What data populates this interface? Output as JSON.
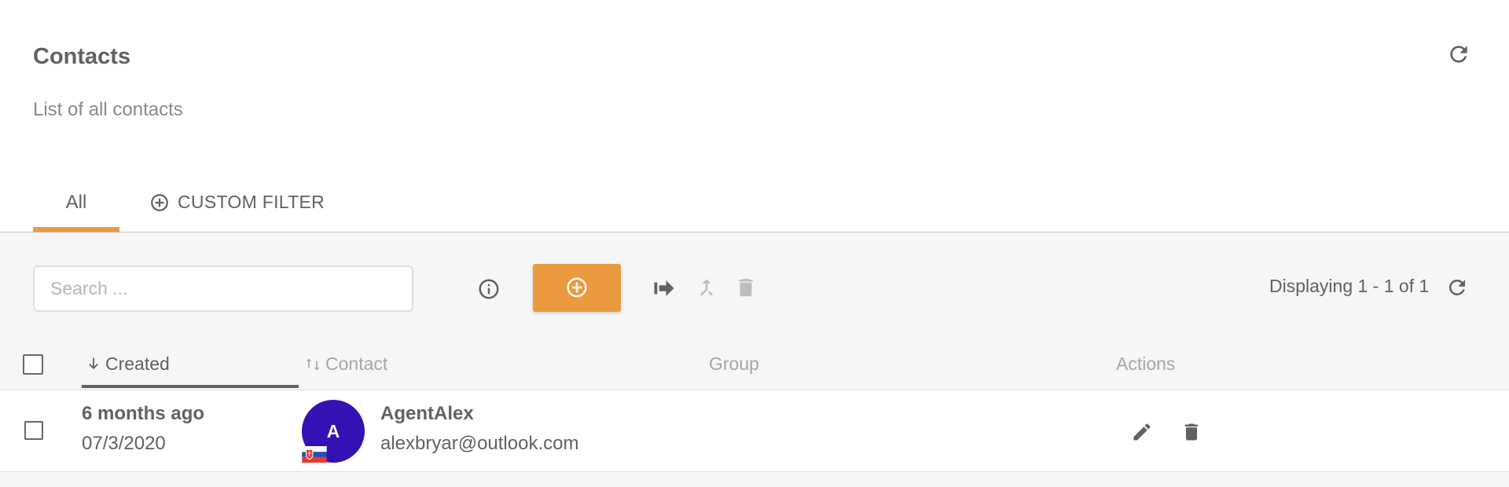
{
  "header": {
    "title": "Contacts",
    "subtitle": "List of all contacts",
    "refresh_icon": "refresh-icon"
  },
  "tabs": [
    {
      "label": "All",
      "active": true
    },
    {
      "label": "CUSTOM FILTER",
      "icon": "add-circle-outline-icon",
      "active": false
    }
  ],
  "toolbar": {
    "search_placeholder": "Search ...",
    "search_value": "",
    "info_icon": "info-icon",
    "add_icon": "add-circle-icon",
    "export_icon": "export-icon",
    "merge_icon": "merge-icon",
    "delete_icon": "trash-icon",
    "displaying": "Displaying 1 - 1 of 1",
    "refresh_icon": "refresh-icon"
  },
  "table": {
    "columns": [
      {
        "label": "Created",
        "sort": "descending",
        "active": true
      },
      {
        "label": "Contact",
        "sort": "none",
        "active": false
      },
      {
        "label": "Group"
      },
      {
        "label": "Actions"
      }
    ],
    "rows": [
      {
        "created_relative": "6 months ago",
        "created_date": "07/3/2020",
        "avatar_initial": "A",
        "avatar_color": "#3411b5",
        "flag_icon": "slovakia-flag-icon",
        "name": "AgentAlex",
        "email": "alexbryar@outlook.com",
        "group": "",
        "actions": [
          "edit-icon",
          "trash-icon"
        ]
      }
    ]
  },
  "colors": {
    "accent": "#ec9a3e",
    "text": "#616161",
    "muted": "#a6a6a6",
    "background": "#f6f6f7",
    "avatar": "#3411b5"
  }
}
